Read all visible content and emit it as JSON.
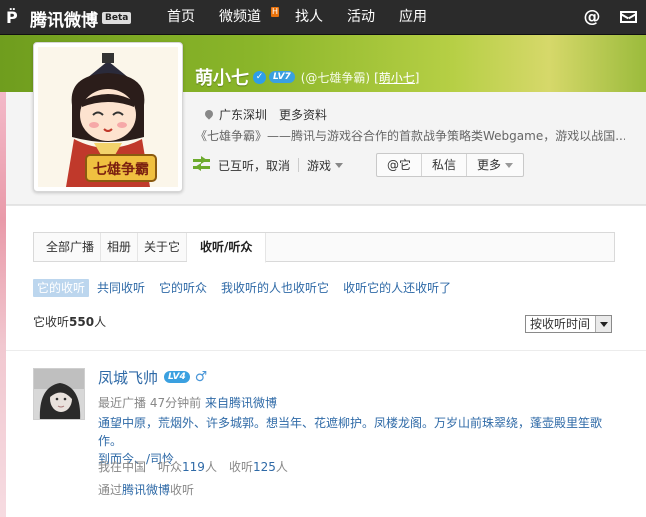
{
  "topnav": {
    "logo_text": "腾讯微博",
    "beta": "Beta",
    "items": [
      {
        "label": "首页"
      },
      {
        "label": "微频道",
        "badge": "H"
      },
      {
        "label": "找人"
      },
      {
        "label": "活动"
      },
      {
        "label": "应用"
      }
    ]
  },
  "profile": {
    "name": "萌小七",
    "level": "LV7",
    "handle": "(@七雄争霸)",
    "alias": "[萌小七]",
    "location": "广东深圳",
    "more_info": "更多资料",
    "intro": "《七雄争霸》——腾讯与游戏谷合作的首款战争策略类Webgame，游戏以战国...",
    "mutual_status": "已互听，取消",
    "group": "游戏",
    "buttons": {
      "at": "@它",
      "message": "私信",
      "more": "更多"
    }
  },
  "tabs": [
    {
      "label": "全部广播",
      "active": false
    },
    {
      "label": "相册",
      "active": false
    },
    {
      "label": "关于它",
      "active": false
    },
    {
      "label": "收听/听众",
      "active": true
    }
  ],
  "subtabs": [
    {
      "label": "它的收听",
      "active": true
    },
    {
      "label": "共同收听",
      "active": false
    },
    {
      "label": "它的听众",
      "active": false
    },
    {
      "label": "我收听的人也收听它",
      "active": false
    },
    {
      "label": "收听它的人还收听了",
      "active": false
    }
  ],
  "listing": {
    "count_prefix": "它收听",
    "count": "550",
    "count_suffix": "人",
    "sort_value": "按收听时间"
  },
  "users": [
    {
      "name": "凤城飞帅",
      "level": "LV4",
      "gender": "♂",
      "recent_prefix": "最近广播",
      "recent_time": "47分钟前",
      "recent_source": "来自腾讯微博",
      "post_line1": "通望中原，荒烟外、许多城郭。想当年、花遮柳护。凤楼龙阁。万岁山前珠翠绕，蓬壶殿里笙歌作。",
      "post_line2": "到而今、/司怜",
      "location": "我在中国",
      "listen_label": "听众",
      "listen_count": "119",
      "listen_suffix": "人",
      "follow_label": "收听",
      "follow_count": "125",
      "follow_suffix": "人",
      "via_prefix": "通过",
      "via_source": "腾讯微博",
      "via_suffix": "收听"
    }
  ]
}
